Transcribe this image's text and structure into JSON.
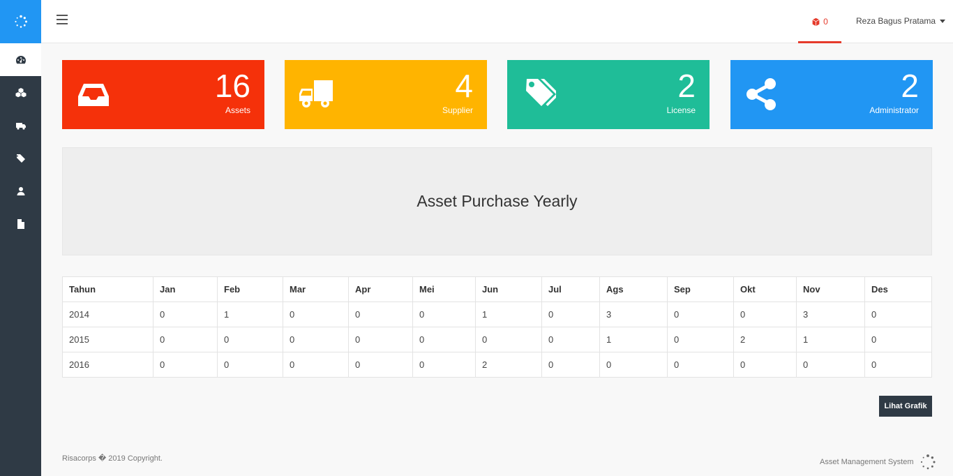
{
  "topbar": {
    "cart_count": "0",
    "user_name": "Reza Bagus Pratama"
  },
  "sidebar": {
    "items": [
      {
        "icon": "dashboard-icon",
        "active": true
      },
      {
        "icon": "cubes-icon",
        "active": false
      },
      {
        "icon": "truck-icon",
        "active": false
      },
      {
        "icon": "tags-icon",
        "active": false
      },
      {
        "icon": "user-icon",
        "active": false
      },
      {
        "icon": "file-icon",
        "active": false
      }
    ]
  },
  "cards": [
    {
      "value": "16",
      "label": "Assets",
      "color": "#f5310a",
      "icon": "inbox-icon"
    },
    {
      "value": "4",
      "label": "Supplier",
      "color": "#ffb400",
      "icon": "truck-icon"
    },
    {
      "value": "2",
      "label": "License",
      "color": "#1fbd98",
      "icon": "tags-icon"
    },
    {
      "value": "2",
      "label": "Administrator",
      "color": "#2196f3",
      "icon": "share-icon"
    }
  ],
  "panel": {
    "title": "Asset Purchase Yearly"
  },
  "table": {
    "headers": [
      "Tahun",
      "Jan",
      "Feb",
      "Mar",
      "Apr",
      "Mei",
      "Jun",
      "Jul",
      "Ags",
      "Sep",
      "Okt",
      "Nov",
      "Des"
    ],
    "rows": [
      [
        "2014",
        "0",
        "1",
        "0",
        "0",
        "0",
        "1",
        "0",
        "3",
        "0",
        "0",
        "3",
        "0"
      ],
      [
        "2015",
        "0",
        "0",
        "0",
        "0",
        "0",
        "0",
        "0",
        "1",
        "0",
        "2",
        "1",
        "0"
      ],
      [
        "2016",
        "0",
        "0",
        "0",
        "0",
        "0",
        "2",
        "0",
        "0",
        "0",
        "0",
        "0",
        "0"
      ]
    ]
  },
  "button": {
    "label": "Lihat Grafik"
  },
  "footer": {
    "left": "Risacorps � 2019 Copyright.",
    "right": "Asset Management System"
  },
  "colors": {
    "sidebar": "#2f3a45",
    "accent_blue": "#2196f3",
    "cart_red": "#e53b2c"
  }
}
